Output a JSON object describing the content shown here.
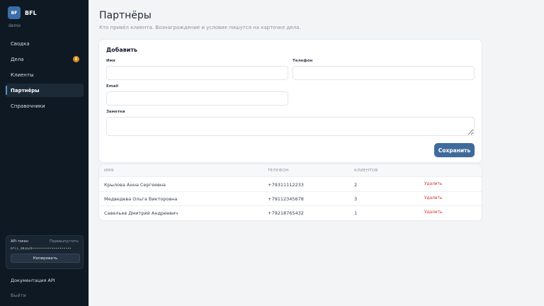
{
  "brand": {
    "logo": "BF",
    "name": "BFL",
    "sub": "demo"
  },
  "nav": {
    "items": [
      {
        "label": "Сводка"
      },
      {
        "label": "Дела",
        "badge": "5"
      },
      {
        "label": "Клиенты"
      },
      {
        "label": "Партнёры",
        "active": true
      },
      {
        "label": "Справочники"
      }
    ]
  },
  "api": {
    "label": "API-токен",
    "regen": "Перевыпустить",
    "token": "bfl1_d83a29••••••••••••••••••••",
    "copy": "Копировать"
  },
  "footer": {
    "docs": "Документация API",
    "logout": "Выйти"
  },
  "page": {
    "title": "Партнёры",
    "subtitle": "Кто привёл клиента. Вознаграждение и условие пишутся на карточке дела."
  },
  "form": {
    "title": "Добавить",
    "name_label": "Имя",
    "phone_label": "Телефон",
    "email_label": "Email",
    "notes_label": "Заметки",
    "name_value": "",
    "phone_value": "",
    "email_value": "",
    "notes_value": "",
    "save": "Сохранить"
  },
  "table": {
    "headers": [
      "ИМЯ",
      "ТЕЛЕФОН",
      "КЛИЕНТОВ"
    ],
    "delete_label": "Удалить",
    "rows": [
      {
        "name": "Крылова Анна Сергеевна",
        "phone": "+79311112233",
        "clients": "2"
      },
      {
        "name": "Медведева Ольга Викторовна",
        "phone": "+79112345678",
        "clients": "3"
      },
      {
        "name": "Савельев Дмитрий Андреевич",
        "phone": "+79218765432",
        "clients": "1"
      }
    ]
  },
  "colors": {
    "sidebar": "#0f1923",
    "accent": "#3f6b9c",
    "badge": "#d98e1a",
    "danger": "#d0352f"
  }
}
